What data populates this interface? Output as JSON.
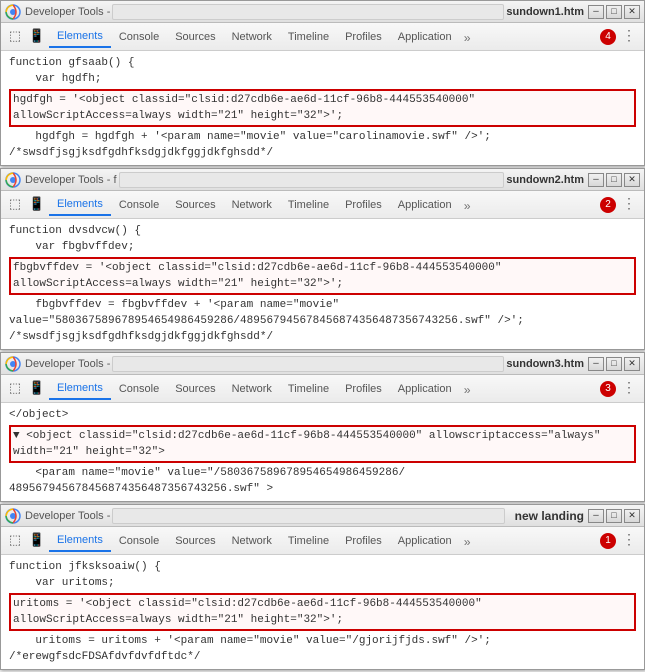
{
  "windows": [
    {
      "id": "window1",
      "title": "Developer Tools - ",
      "url_placeholder": "",
      "filename": "sundown1.htm",
      "error_count": "4",
      "tabs": [
        "Elements",
        "Console",
        "Sources",
        "Network",
        "Timeline",
        "Profiles",
        "Application"
      ],
      "active_tab": "Elements",
      "code_lines": [
        "function gfsaab() {",
        "    var hgdfh;"
      ],
      "highlight_lines": [
        "    hgdfgh = '<object classid=\"clsid:d27cdb6e-ae6d-11cf-96b8-444553540000\"",
        "allowScriptAccess=always width=\"21\" height=\"32\">';"
      ],
      "code_lines2": [
        "    hgdfgh = hgdfgh + '<param name=\"movie\" value=\"carolinamovie.swf\" />';",
        "/*swsdfjsgjksdfgdhfksdgjdkfggjdkfghsdd*/"
      ]
    },
    {
      "id": "window2",
      "title": "Developer Tools - f",
      "url_placeholder": "",
      "filename": "sundown2.htm",
      "error_count": "2",
      "tabs": [
        "Elements",
        "Console",
        "Sources",
        "Network",
        "Timeline",
        "Profiles",
        "Application"
      ],
      "active_tab": "Elements",
      "code_lines": [
        "function dvsdvcw() {",
        "    var fbgbvffdev;"
      ],
      "highlight_lines": [
        "    fbgbvffdev = '<object classid=\"clsid:d27cdb6e-ae6d-11cf-96b8-444553540000\"",
        "allowScriptAccess=always width=\"21\" height=\"32\">';"
      ],
      "code_lines2": [
        "    fbgbvffdev = fbgbvffdev + '<param name=\"movie\"",
        "value=\"580367589678954654986459286/489567945678456874356487356743256.swf\" />';",
        "/*swsdfjsgjksdfgdhfksdgjdkfggjdkfghsdd*/"
      ]
    },
    {
      "id": "window3",
      "title": "Developer Tools - ",
      "url_placeholder": "",
      "filename": "sundown3.htm",
      "error_count": "3",
      "tabs": [
        "Elements",
        "Console",
        "Sources",
        "Network",
        "Timeline",
        "Profiles",
        "Application"
      ],
      "active_tab": "Elements",
      "code_lines": [
        "</object>"
      ],
      "highlight_lines": [
        "▼ <object classid=\"clsid:d27cdb6e-ae6d-11cf-96b8-444553540000\" allowscriptaccess=\"always\"",
        "width=\"21\" height=\"32\">"
      ],
      "code_lines2": [
        "    <param name=\"movie\" value=\"/580367589678954654986459286/",
        "489567945678456874356487356743256.swf\" >"
      ]
    },
    {
      "id": "window4",
      "title": "Developer Tools - ",
      "url_placeholder": "",
      "filename": "",
      "badge_text": "new landing",
      "error_count": "1",
      "tabs": [
        "Elements",
        "Console",
        "Sources",
        "Network",
        "Timeline",
        "Profiles",
        "Application"
      ],
      "active_tab": "Elements",
      "code_lines": [
        "function jfksksoaiw() {",
        "    var uritoms;"
      ],
      "highlight_lines": [
        "    uritoms = '<object classid=\"clsid:d27cdb6e-ae6d-11cf-96b8-444553540000\"",
        "allowScriptAccess=always width=\"21\" height=\"32\">';"
      ],
      "code_lines2": [
        "    uritoms = uritoms + '<param name=\"movie\" value=\"/gjorijfjds.swf\" />';",
        "/*erewgfsdcFDSAfdvfdvfdftdc*/"
      ]
    }
  ],
  "labels": {
    "elements": "Elements",
    "console": "Console",
    "sources": "Sources",
    "network": "Network",
    "timeline": "Timeline",
    "profiles": "Profiles",
    "application": "Application"
  }
}
